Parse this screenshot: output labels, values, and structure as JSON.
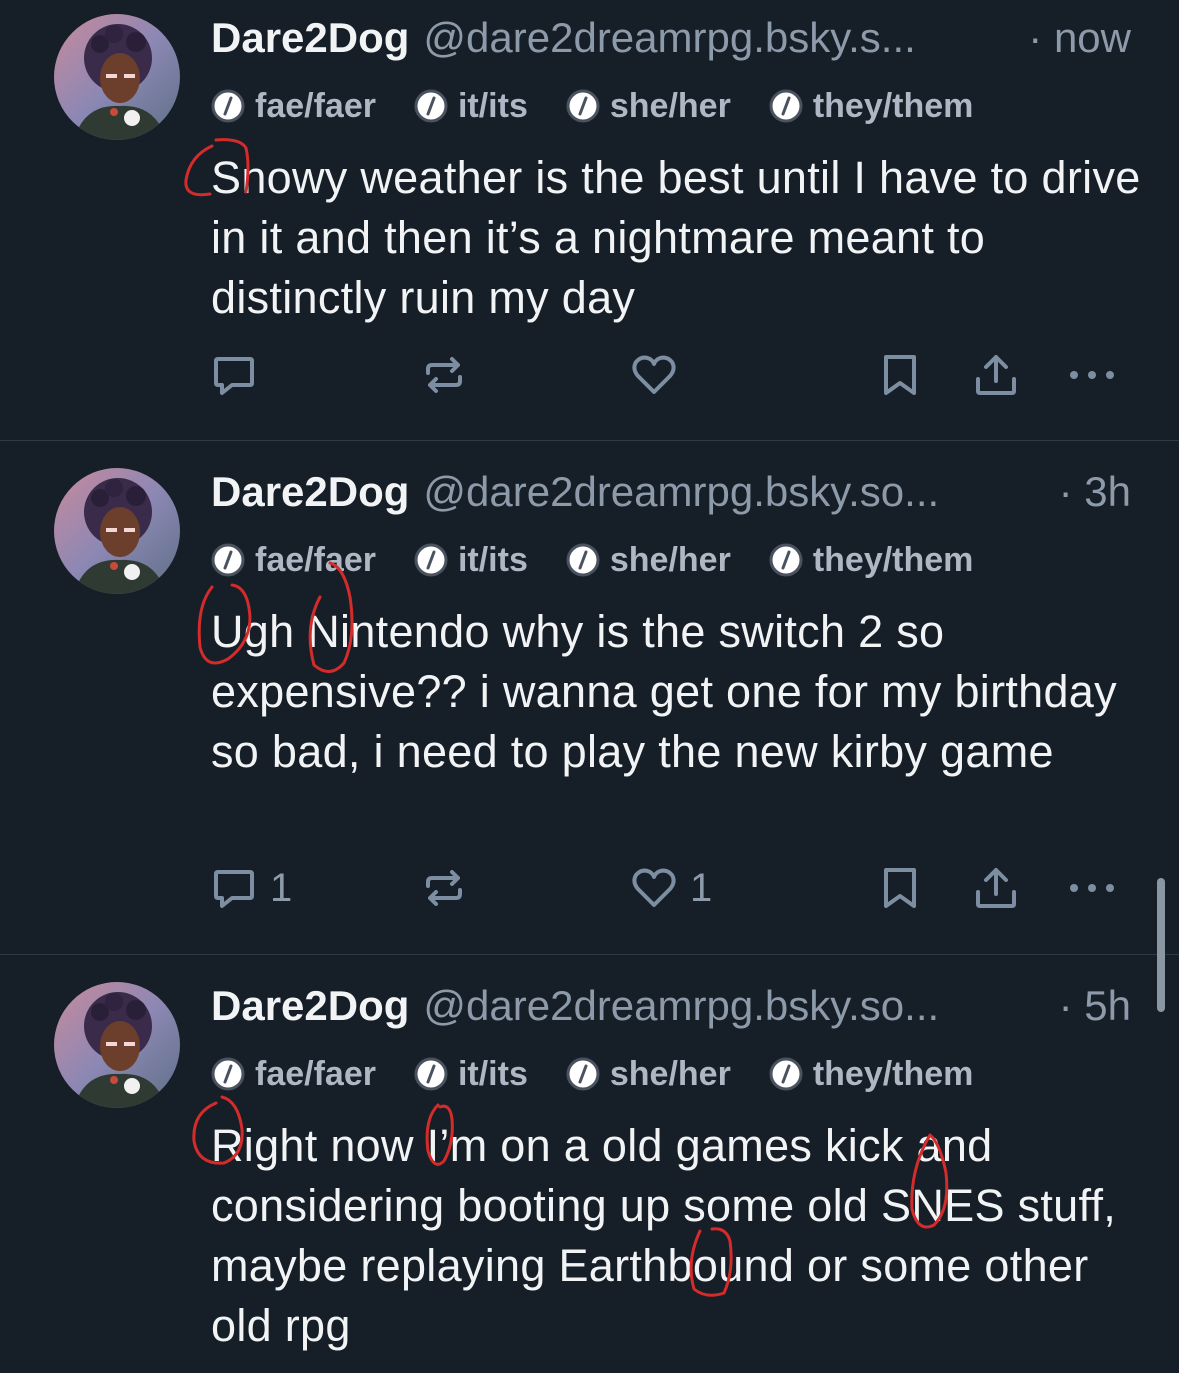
{
  "posts": [
    {
      "author": "Dare2Dog",
      "handle": "@dare2dreamrpg.bsky.s...",
      "time": "· now",
      "pronouns": [
        "fae/faer",
        "it/its",
        "she/her",
        "they/them"
      ],
      "text": "Snowy weather is the best until I have to drive in it and then it’s a nightmare meant to distinctly ruin my day",
      "reply_count": "",
      "repost_count": "",
      "like_count": ""
    },
    {
      "author": "Dare2Dog",
      "handle": "@dare2dreamrpg.bsky.so...",
      "time": "· 3h",
      "pronouns": [
        "fae/faer",
        "it/its",
        "she/her",
        "they/them"
      ],
      "text": "Ugh Nintendo why is the switch 2 so expensive??  i wanna get one for my birthday so bad, i need to play the new kirby game",
      "reply_count": "1",
      "repost_count": "",
      "like_count": "1"
    },
    {
      "author": "Dare2Dog",
      "handle": "@dare2dreamrpg.bsky.so...",
      "time": "· 5h",
      "pronouns": [
        "fae/faer",
        "it/its",
        "she/her",
        "they/them"
      ],
      "text": "Right now I’m on a old games kick and considering booting up some old SNES stuff, maybe replaying Earthbound or some other old rpg"
    }
  ],
  "icons": {
    "reply": "reply-bubble-icon",
    "repost": "repost-icon",
    "like": "heart-icon",
    "bookmark": "bookmark-icon",
    "share": "share-icon",
    "more": "more-dots-icon",
    "pronoun": "pronoun-badge-icon"
  },
  "colors": {
    "background": "#161e27",
    "text": "#f1f3f5",
    "muted": "#8d9aa9",
    "icon": "#7d8ea3",
    "annotation": "#d42b2b"
  }
}
